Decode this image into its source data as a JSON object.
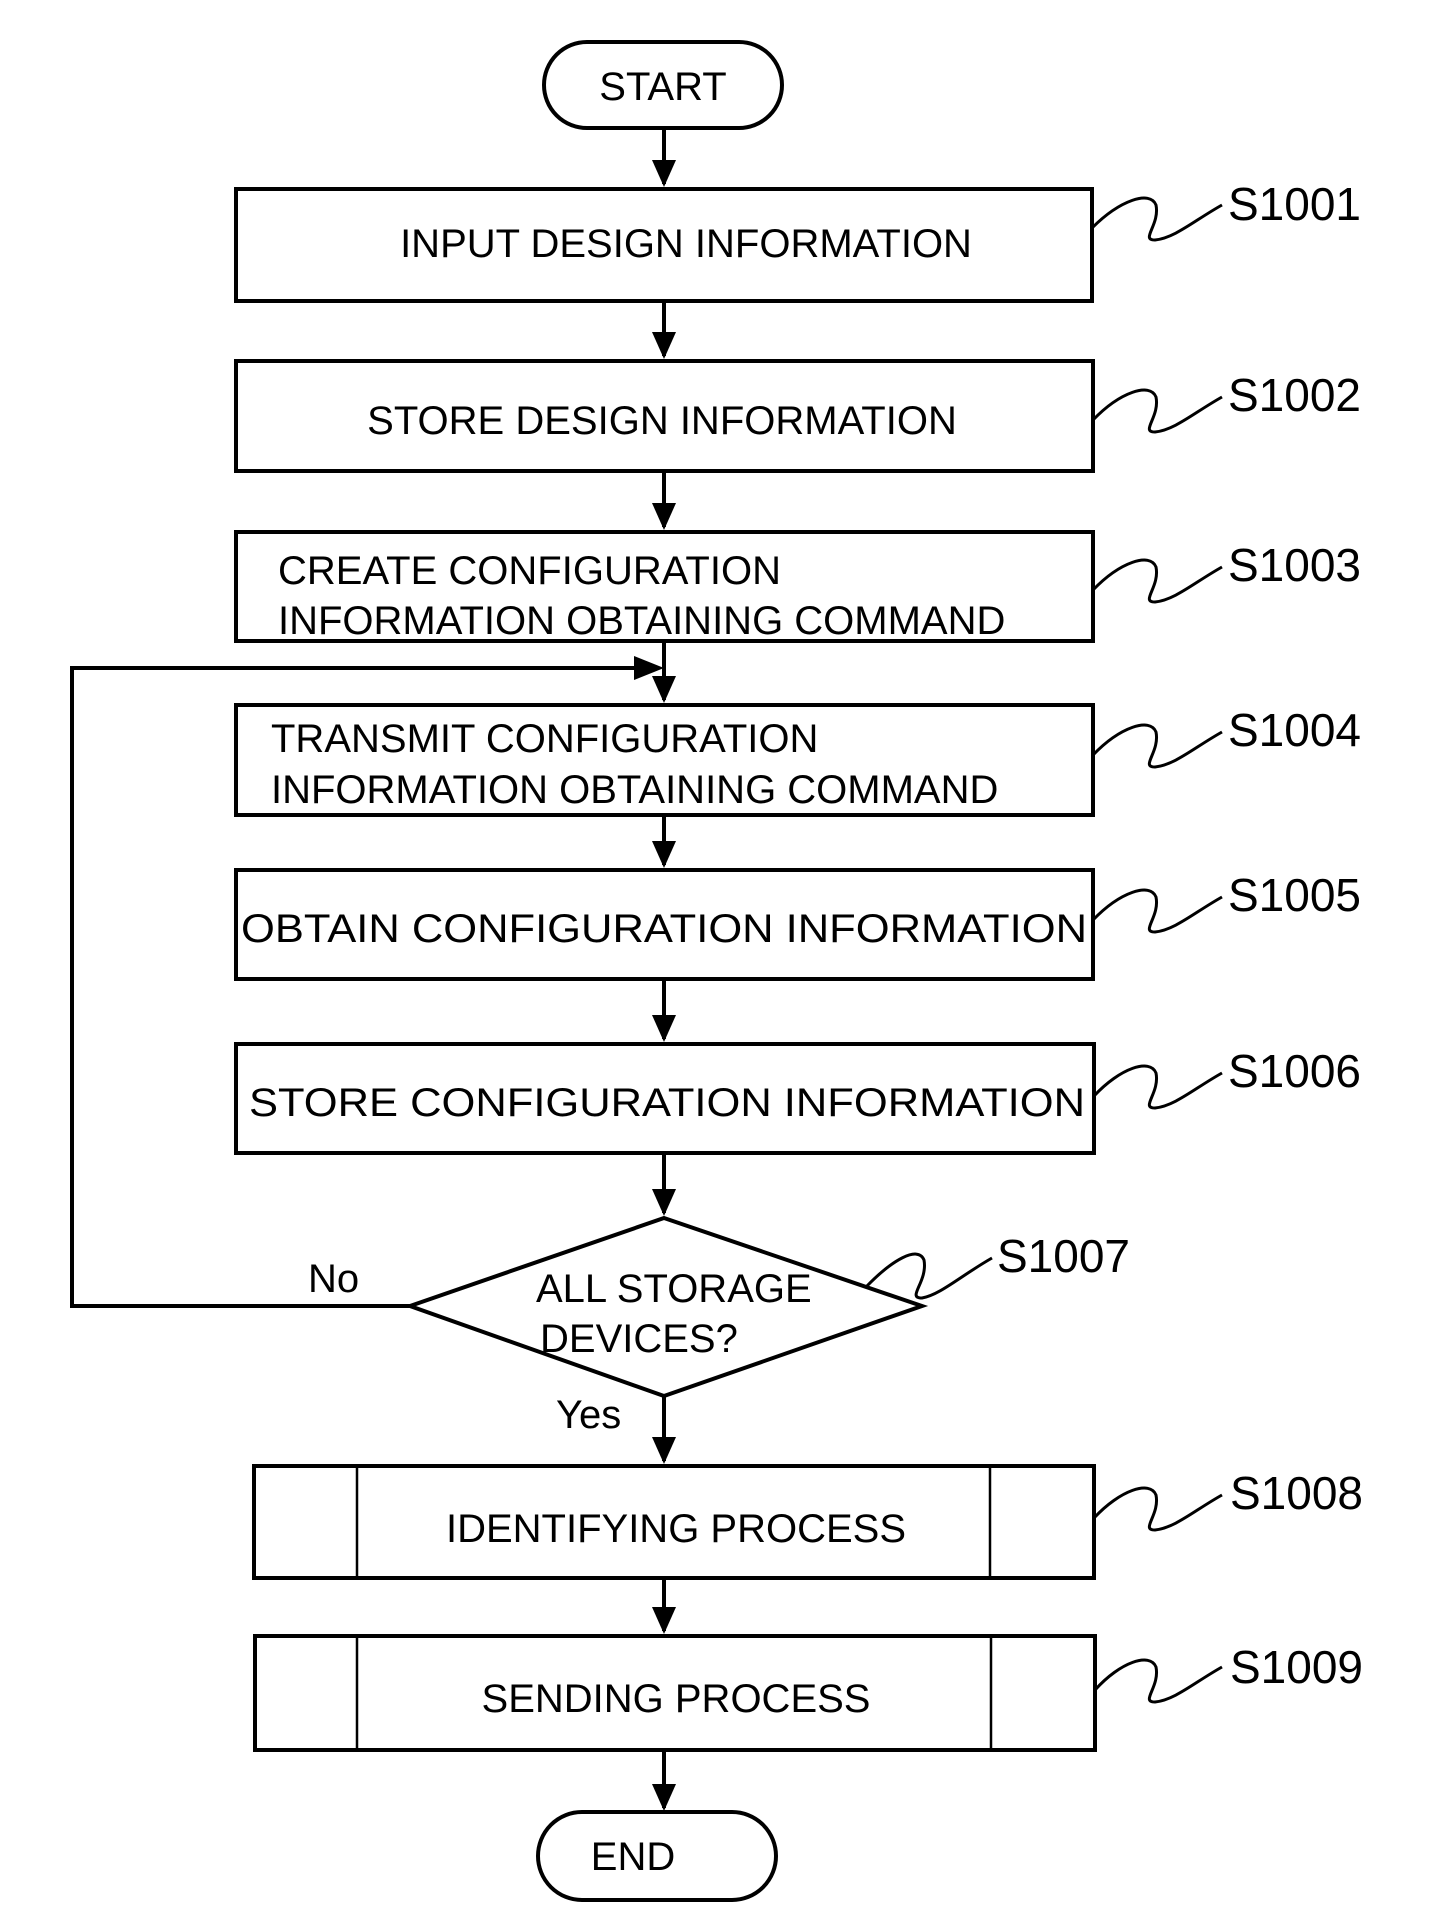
{
  "diagram": {
    "type": "flowchart",
    "start": "START",
    "end": "END",
    "steps": [
      {
        "id": "S1001",
        "lines": [
          "INPUT DESIGN INFORMATION"
        ],
        "kind": "process"
      },
      {
        "id": "S1002",
        "lines": [
          "STORE DESIGN INFORMATION"
        ],
        "kind": "process"
      },
      {
        "id": "S1003",
        "lines": [
          "CREATE CONFIGURATION",
          "INFORMATION OBTAINING COMMAND"
        ],
        "kind": "process"
      },
      {
        "id": "S1004",
        "lines": [
          "TRANSMIT CONFIGURATION",
          "INFORMATION OBTAINING COMMAND"
        ],
        "kind": "process"
      },
      {
        "id": "S1005",
        "lines": [
          "OBTAIN CONFIGURATION INFORMATION"
        ],
        "kind": "process"
      },
      {
        "id": "S1006",
        "lines": [
          "STORE CONFIGURATION INFORMATION"
        ],
        "kind": "process"
      },
      {
        "id": "S1007",
        "lines": [
          "ALL STORAGE",
          "DEVICES?"
        ],
        "kind": "decision"
      },
      {
        "id": "S1008",
        "lines": [
          "IDENTIFYING PROCESS"
        ],
        "kind": "subprocess"
      },
      {
        "id": "S1009",
        "lines": [
          "SENDING PROCESS"
        ],
        "kind": "subprocess"
      }
    ],
    "decision_labels": {
      "no": "No",
      "yes": "Yes"
    }
  }
}
